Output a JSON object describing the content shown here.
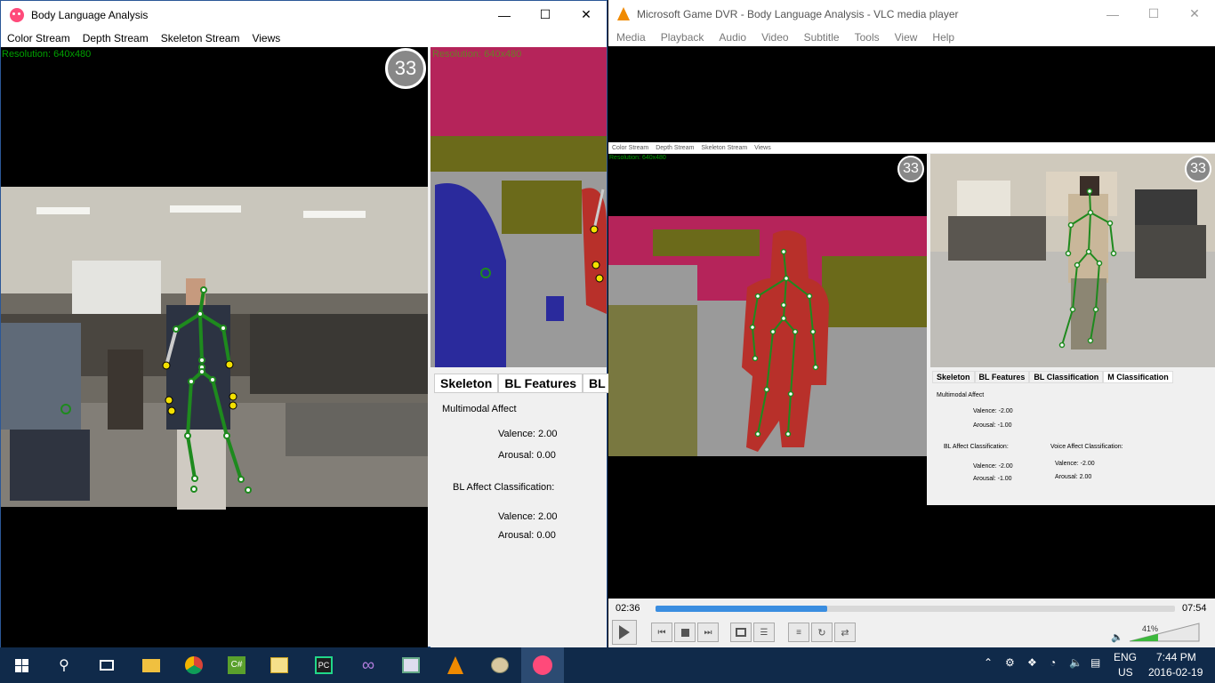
{
  "left_window": {
    "title": "Body Language Analysis",
    "menu": [
      "Color Stream",
      "Depth Stream",
      "Skeleton Stream",
      "Views"
    ],
    "color_resolution": "Resolution: 640x480",
    "depth_resolution": "Resolution: 640x480",
    "fps": "33",
    "tabs": [
      "Skeleton",
      "BL Features",
      "BL C"
    ],
    "multimodal_heading": "Multimodal Affect",
    "multimodal_valence": "Valence:  2.00",
    "multimodal_arousal": "Arousal:  0.00",
    "bl_heading": "BL Affect Classification:",
    "bl_valence": "Valence:  2.00",
    "bl_arousal": "Arousal:  0.00"
  },
  "vlc_window": {
    "title": "Microsoft Game DVR - Body Language Analysis - VLC media player",
    "menu": [
      "Media",
      "Playback",
      "Audio",
      "Video",
      "Subtitle",
      "Tools",
      "View",
      "Help"
    ],
    "time_elapsed": "02:36",
    "time_total": "07:54",
    "progress": 0.33,
    "volume": "41%",
    "volume_level": 0.41
  },
  "embedded": {
    "menu": [
      "Color Stream",
      "Depth Stream",
      "Skeleton Stream",
      "Views"
    ],
    "resolution": "Resolution: 640x480",
    "fps_left": "33",
    "fps_right": "33",
    "tabs": [
      "Skeleton",
      "BL Features",
      "BL Classification",
      "M Classification"
    ],
    "multimodal_heading": "Multimodal Affect",
    "m_valence": "Valence:  -2.00",
    "m_arousal": "Arousal:  -1.00",
    "bl_heading": "BL Affect Classification:",
    "bl_valence": "Valence:  -2.00",
    "bl_arousal": "Arousal:  -1.00",
    "voice_heading": "Voice Affect Classification:",
    "voice_valence": "Valence:  -2.00",
    "voice_arousal": "Arousal:  2.00"
  },
  "taskbar": {
    "lang_top": "ENG",
    "lang_bottom": "US",
    "time": "7:44 PM",
    "date": "2016-02-19"
  },
  "colors": {
    "magenta": "#b5245a",
    "olive": "#6b6a1a",
    "navy": "#2a2a9c",
    "red": "#b8302a",
    "gray": "#9a9a9a",
    "skeleton_green": "#1e8a1e",
    "joint_yellow": "#f3e000",
    "vlc_progress": "#3a8de0"
  }
}
